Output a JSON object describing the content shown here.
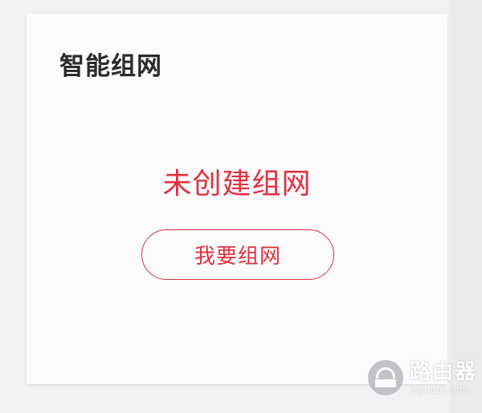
{
  "card": {
    "title": "智能组网",
    "status": "未创建组网",
    "button_label": "我要组网"
  },
  "watermark": {
    "brand": "路由器",
    "url": "luyouqi.com",
    "icon": "router-logo-icon"
  },
  "colors": {
    "accent": "#e0323f",
    "title": "#2b2b2d",
    "card_background": "#fbfafc",
    "page_background": "#f2f1f3"
  }
}
